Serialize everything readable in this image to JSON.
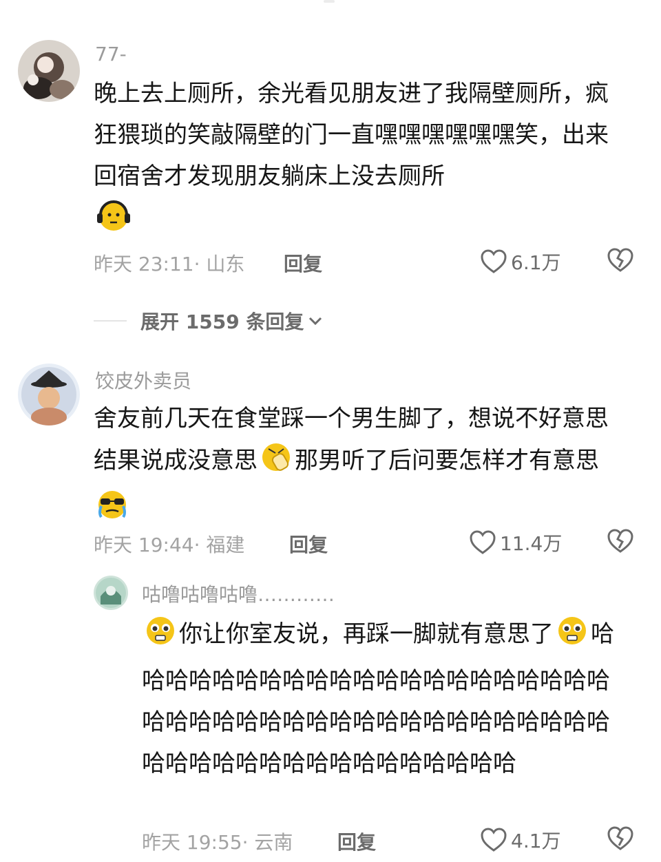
{
  "comments": [
    {
      "username": "77-",
      "text_parts": [
        "晚上去上厕所，余光看见朋友进了我隔壁厕所，疯狂猥琐的笑敲隔壁的门一直嘿嘿嘿嘿嘿嘿笑，出来回宿舍才发现朋友躺床上没去厕所"
      ],
      "emoji_after": "headphones-face-emoji",
      "date": "昨天 23:11",
      "location": "山东",
      "meta": "昨天 23:11· 山东",
      "reply_label": "回复",
      "likes": "6.1万"
    },
    {
      "username": "饺皮外卖员",
      "text_1": "舍友前几天在食堂踩一个男生脚了，想说不好意思结果说成没意思",
      "text_2": "那男听了后问要怎样才有意思",
      "meta": "昨天 19:44· 福建",
      "reply_label": "回复",
      "likes": "11.4万"
    }
  ],
  "expand_replies": "展开 1559 条回复",
  "reply": {
    "username": "咕噜咕噜咕噜…………",
    "text_1": "你让你室友说，再踩一脚就有意思了",
    "text_2": "哈哈哈哈哈哈哈哈哈哈哈哈哈哈哈哈哈哈哈哈哈哈哈哈哈哈哈哈哈哈哈哈哈哈哈哈哈哈哈哈哈哈哈哈哈哈哈哈哈哈哈哈哈哈哈哈哈",
    "meta": "昨天 19:55· 云南",
    "reply_label": "回复",
    "likes": "4.1万"
  },
  "colors": {
    "text": "#161616",
    "meta": "#a3a3a3",
    "action": "#6b6b6b",
    "emoji_yellow": "#f5c518"
  }
}
